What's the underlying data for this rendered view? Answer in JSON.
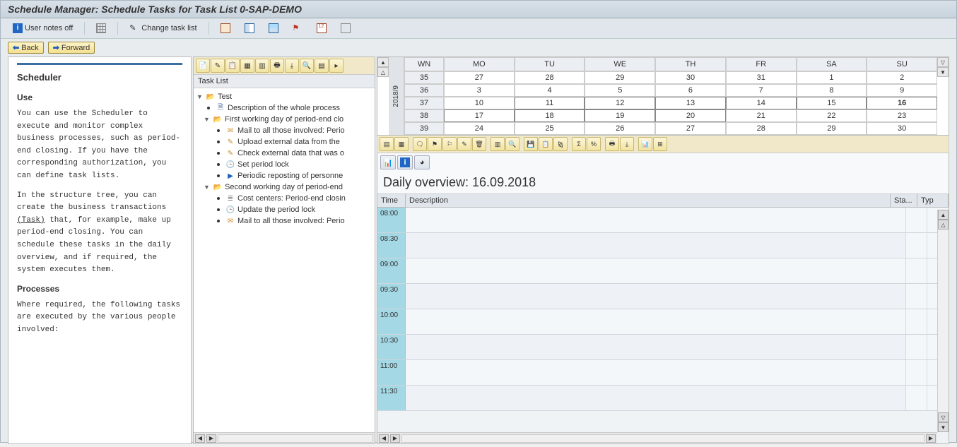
{
  "title": "Schedule Manager: Schedule Tasks for Task List 0-SAP-DEMO",
  "toolbar": {
    "user_notes": "User notes off",
    "change_task": "Change task list"
  },
  "nav": {
    "back": "Back",
    "forward": "Forward"
  },
  "scheduler": {
    "heading": "Scheduler",
    "use_h": "Use",
    "use_p1": "You can use the Scheduler to execute and monitor complex business processes, such as period-end closing. If you have the corresponding authorization, you can define task lists.",
    "use_p2a": "In the structure tree, you can create the business transactions ",
    "use_link": "(Task)",
    "use_p2b": " that, for example, make up period-end closing. You can schedule these tasks in the daily overview, and if required, the system executes them.",
    "proc_h": "Processes",
    "proc_p": "Where required, the following tasks are executed by the various people involved:"
  },
  "tree": {
    "header": "Task List",
    "root": "Test",
    "items": [
      "Description of the whole process",
      "First working day of period-end clo",
      "Mail to all those involved: Perio",
      "Upload external data from the",
      "Check external data that was o",
      "Set period lock",
      "Periodic reposting of personne",
      "Second working day of period-end",
      "Cost centers: Period-end closin",
      "Update the period lock",
      "Mail to all those involved: Perio"
    ]
  },
  "calendar": {
    "ym": "2018/9",
    "headers": [
      "WN",
      "MO",
      "TU",
      "WE",
      "TH",
      "FR",
      "SA",
      "SU"
    ],
    "rows": [
      [
        "35",
        "27",
        "28",
        "29",
        "30",
        "31",
        "1",
        "2"
      ],
      [
        "36",
        "3",
        "4",
        "5",
        "6",
        "7",
        "8",
        "9"
      ],
      [
        "37",
        "10",
        "11",
        "12",
        "13",
        "14",
        "15",
        "16"
      ],
      [
        "38",
        "17",
        "18",
        "19",
        "20",
        "21",
        "22",
        "23"
      ],
      [
        "39",
        "24",
        "25",
        "26",
        "27",
        "28",
        "29",
        "30"
      ]
    ]
  },
  "overview": {
    "title": "Daily overview: 16.09.2018",
    "cols": {
      "time": "Time",
      "desc": "Description",
      "sta": "Sta...",
      "typ": "Typ"
    },
    "times": [
      "08:00",
      "08:30",
      "09:00",
      "09:30",
      "10:00",
      "10:30",
      "11:00",
      "11:30"
    ]
  }
}
